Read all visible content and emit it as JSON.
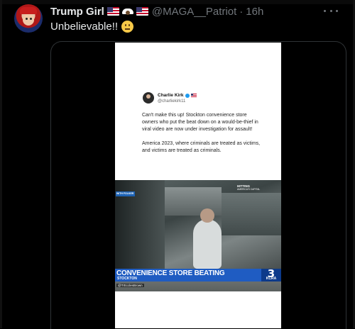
{
  "post": {
    "display_name": "Trump Girl",
    "handle": "@MAGA__Patriot",
    "separator": "·",
    "time": "16h",
    "text": "Unbelievable!!",
    "emoji": "face-with-raised-eyebrow-icon"
  },
  "quoted_post": {
    "name": "Charlie Kirk",
    "handle": "@charliekirk11",
    "paragraph_1": "Can't make this up! Stockton convenience store owners who put the beat down on a would-be-thief in viral video are now under investigation for assault!",
    "paragraph_2": "America 2023, where criminals are treated as victims, and victims are treated as criminals."
  },
  "video": {
    "tag_left": "WITH FOLKER",
    "tag_right_title": "HITTING",
    "tag_right_sub": "AMERICA'S CAPITAL",
    "chyron_title": "CONVENIENCE STORE BEATING",
    "chyron_location": "STOCKTON",
    "station_number": "3",
    "station_name": "KCRA",
    "credit": "@TrEcclesBrown"
  },
  "colors": {
    "background": "#000000",
    "name": "#e7e9ea",
    "secondary": "#71767b",
    "chyron": "#1f5cc2",
    "verified": "#1d9bf0"
  }
}
